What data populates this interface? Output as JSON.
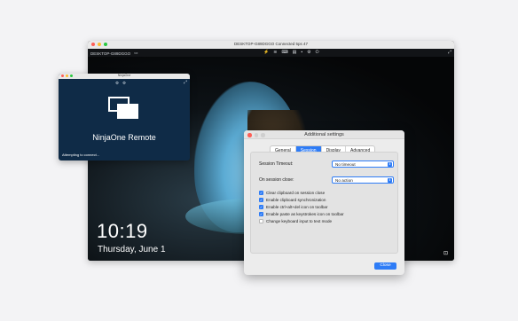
{
  "remote_window": {
    "title": "DESKTOP-G89DGGO Connected 5ps 47",
    "toolbar_host": "DESKTOP-G89DGGO",
    "toolbar_icons": [
      "power-icon",
      "chart-icon",
      "keyboard-icon",
      "clipboard-icon",
      "trash-icon",
      "gear-icon",
      "power-button-icon"
    ],
    "expand_icon": "expand-icon"
  },
  "lock_screen": {
    "time": "10:19",
    "date": "Thursday, June 1"
  },
  "ninja_window": {
    "title": "NinjaOne",
    "app_name": "NinjaOne Remote",
    "status": "Attempting to connect..."
  },
  "settings_dialog": {
    "title": "Additional settings",
    "tabs": [
      {
        "label": "General",
        "active": false
      },
      {
        "label": "Session",
        "active": true
      },
      {
        "label": "Display",
        "active": false
      },
      {
        "label": "Advanced",
        "active": false
      }
    ],
    "session_timeout": {
      "label": "Session Timeout:",
      "value": "No timeout"
    },
    "session_close": {
      "label": "On session close:",
      "value": "No action"
    },
    "checkboxes": [
      {
        "label": "Clear clipboard on session close",
        "checked": true
      },
      {
        "label": "Enable clipboard synchronization",
        "checked": true
      },
      {
        "label": "Enable ctrl+alt+del icon on toolbar",
        "checked": true
      },
      {
        "label": "Enable paste as keystrokes icon on toolbar",
        "checked": true
      },
      {
        "label": "Change keyboard input to text mode",
        "checked": false
      }
    ],
    "close_label": "Close",
    "accent_color": "#2e7cf6"
  }
}
